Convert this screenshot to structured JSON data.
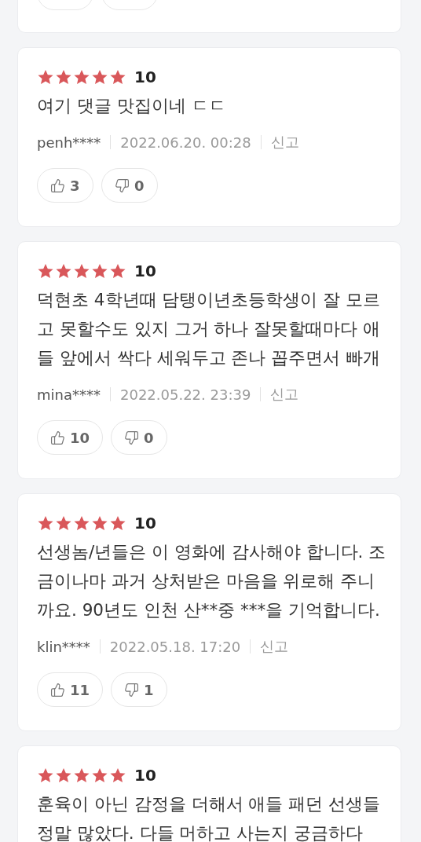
{
  "reviews": [
    {
      "kind": "cut"
    },
    {
      "stars": 5,
      "score": "10",
      "lines": [
        "여기 댓글 맛집이네 ㄷㄷ"
      ],
      "author": "penh****",
      "date": "2022.06.20. 00:28",
      "report": "신고",
      "votes": {
        "likes": "3",
        "dislikes": "0"
      }
    },
    {
      "stars": 5,
      "score": "10",
      "lines": [
        "덕현초 4학년때 담탱이년초등학생이 잘 모르",
        "고 못할수도 있지 그거 하나 잘못할때마다 애",
        "들 앞에서 싹다 세워두고 존나 꼽주면서 빠개"
      ],
      "author": "mina****",
      "date": "2022.05.22. 23:39",
      "report": "신고",
      "votes": {
        "likes": "10",
        "dislikes": "0"
      }
    },
    {
      "stars": 5,
      "score": "10",
      "lines": [
        "선생놈/년들은 이 영화에 감사해야 합니다. 조",
        "금이나마 과거 상처받은 마음을 위로해 주니",
        "까요. 90년도 인천 산**중 ***을 기억합니다."
      ],
      "author": "klin****",
      "date": "2022.05.18. 17:20",
      "report": "신고",
      "votes": {
        "likes": "11",
        "dislikes": "1"
      }
    },
    {
      "stars": 5,
      "score": "10",
      "lines": [
        "훈육이 아닌 감정을 더해서 애들 패던 선생들",
        "정말 많았다. 다들 머하고 사는지 궁금하다"
      ]
    }
  ]
}
